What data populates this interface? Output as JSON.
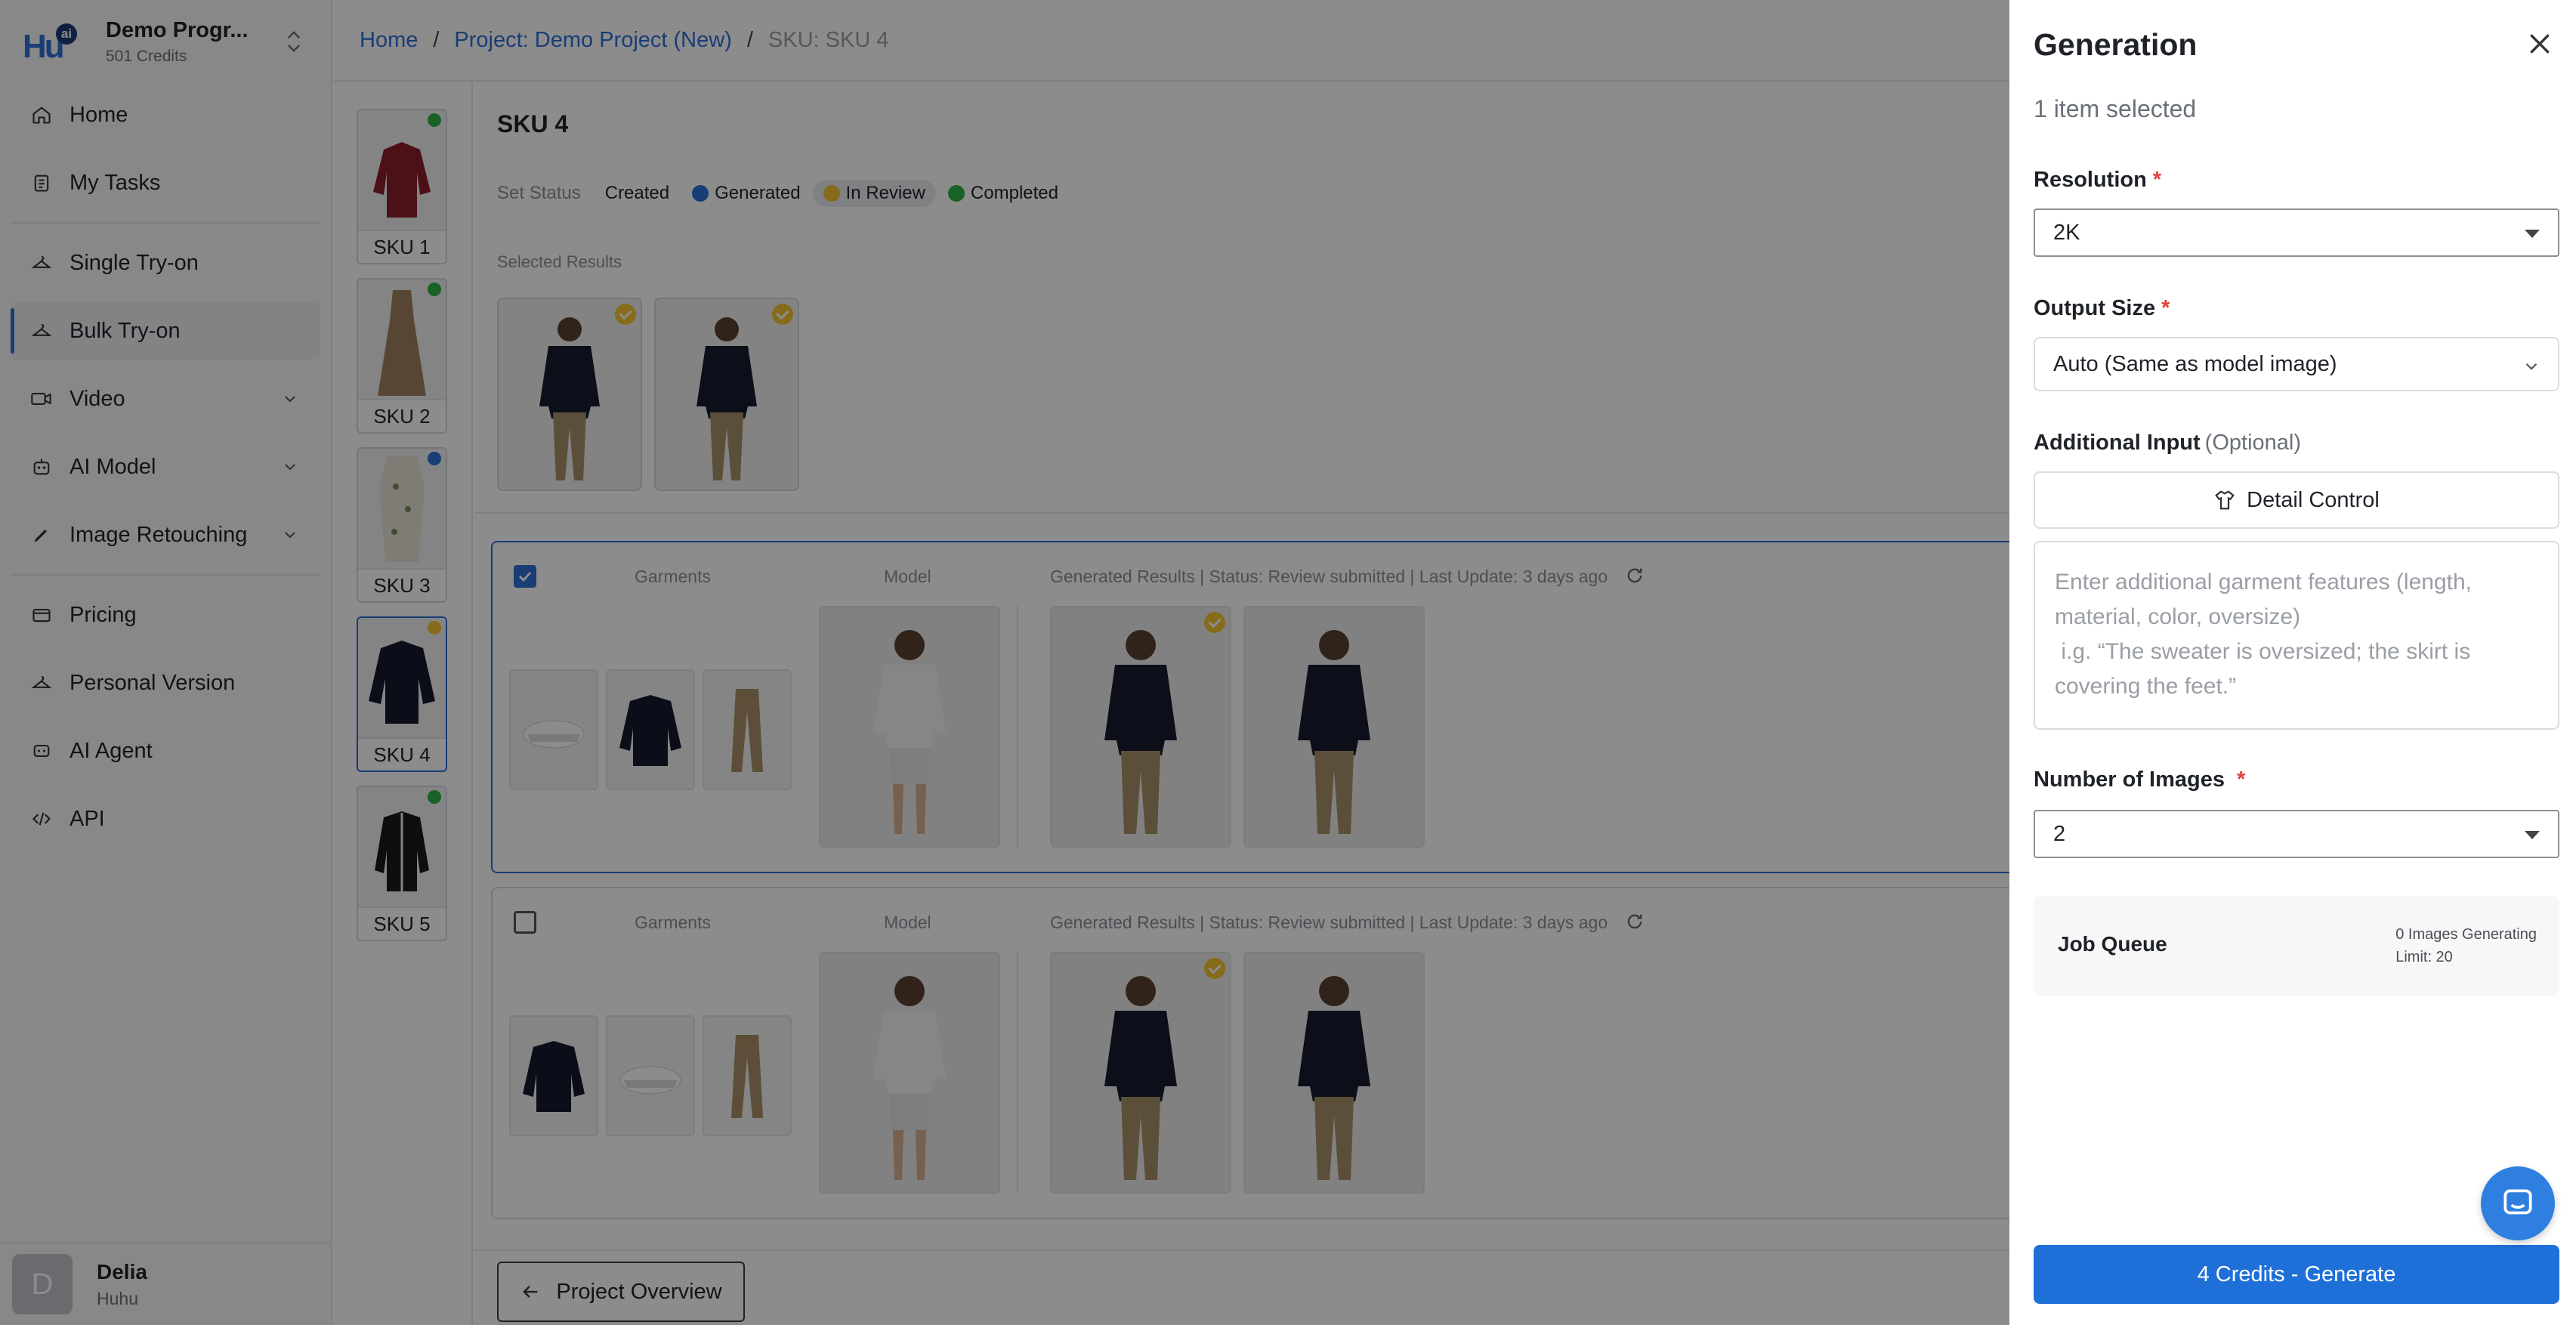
{
  "brand": {
    "name": "Demo Progr...",
    "credits": "501 Credits",
    "logo_text": "Hu",
    "logo_badge": "ai"
  },
  "nav": {
    "home": "Home",
    "my_tasks": "My Tasks",
    "single_tryon": "Single Try-on",
    "bulk_tryon": "Bulk Try-on",
    "video": "Video",
    "ai_model": "AI Model",
    "image_retouching": "Image Retouching",
    "pricing": "Pricing",
    "personal_version": "Personal Version",
    "ai_agent": "AI Agent",
    "api": "API"
  },
  "user": {
    "initial": "D",
    "name": "Delia",
    "org": "Huhu"
  },
  "breadcrumb": {
    "home": "Home",
    "project": "Project: Demo Project (New)",
    "sku": "SKU: SKU 4",
    "sep": "/"
  },
  "skus": [
    {
      "label": "SKU 1",
      "status_color": "#2fb344"
    },
    {
      "label": "SKU 2",
      "status_color": "#2fb344"
    },
    {
      "label": "SKU 3",
      "status_color": "#2f6fd6"
    },
    {
      "label": "SKU 4",
      "status_color": "#f4c430"
    },
    {
      "label": "SKU 5",
      "status_color": "#2fb344"
    }
  ],
  "main": {
    "title": "SKU 4",
    "set_status_label": "Set Status",
    "statuses": [
      {
        "label": "Created",
        "color": ""
      },
      {
        "label": "Generated",
        "color": "#2f6fd6"
      },
      {
        "label": "In Review",
        "color": "#f4c430"
      },
      {
        "label": "Completed",
        "color": "#2fb344"
      }
    ],
    "selected_results_label": "Selected Results",
    "overview_button": "Project Overview"
  },
  "result_cards": [
    {
      "garments_label": "Garments",
      "model_label": "Model",
      "results_label": "Generated Results | Status: Review submitted | Last Update: 3 days ago"
    },
    {
      "garments_label": "Garments",
      "model_label": "Model",
      "results_label": "Generated Results | Status: Review submitted | Last Update: 3 days ago"
    }
  ],
  "panel": {
    "title": "Generation",
    "subtitle": "1 item selected",
    "resolution_label": "Resolution",
    "resolution_value": "2K",
    "output_size_label": "Output Size",
    "output_size_value": "Auto (Same as model image)",
    "additional_input_label": "Additional Input",
    "optional_label": "(Optional)",
    "detail_control_button": "Detail Control",
    "textarea_placeholder": "Enter additional garment features (length, material, color, oversize)\n i.g. “The sweater is oversized; the skirt is covering the feet.”",
    "num_images_label": "Number of Images",
    "num_images_value": "2",
    "required_mark": "*",
    "job_queue_title": "Job Queue",
    "job_queue_generating": "0 Images Generating",
    "job_queue_limit": "Limit: 20",
    "generate_button": "4 Credits - Generate"
  }
}
